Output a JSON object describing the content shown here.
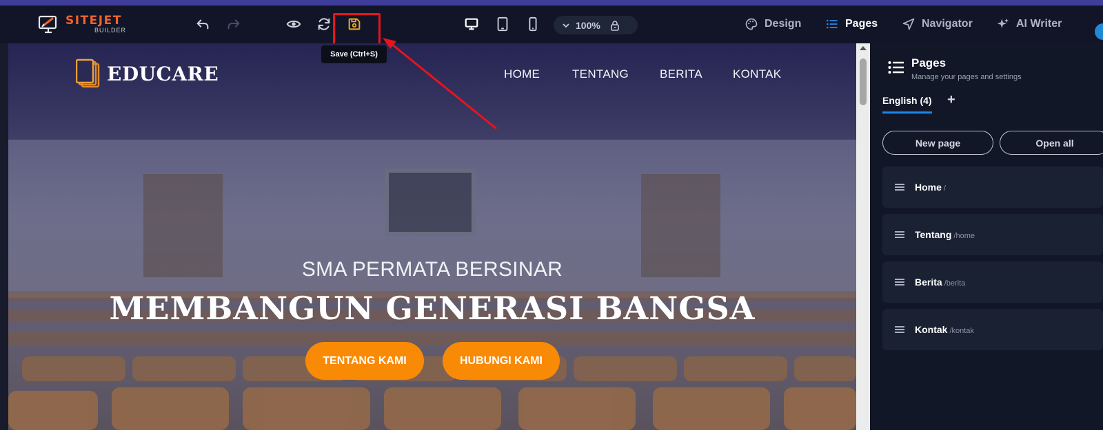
{
  "app": {
    "logo_main": "SITEJET",
    "logo_sub": "BUILDER",
    "zoom": "100%",
    "tooltip": "Save (Ctrl+S)"
  },
  "toolbar_right": {
    "design": "Design",
    "pages": "Pages",
    "navigator": "Navigator",
    "ai_writer": "AI Writer"
  },
  "site": {
    "brand": "EDUCARE",
    "nav": [
      "HOME",
      "TENTANG",
      "BERITA",
      "KONTAK"
    ],
    "hero_sub": "SMA PERMATA BERSINAR",
    "hero_title": "MEMBANGUN GENERASI BANGSA",
    "btn_about": "TENTANG KAMI",
    "btn_contact": "HUBUNGI KAMI"
  },
  "panel": {
    "title": "Pages",
    "desc": "Manage your pages and settings",
    "lang_tab": "English (4)",
    "plus": "+",
    "new_page": "New page",
    "open_all": "Open all",
    "pages": [
      {
        "name": "Home",
        "path": "/"
      },
      {
        "name": "Tentang",
        "path": "/home"
      },
      {
        "name": "Berita",
        "path": "/berita"
      },
      {
        "name": "Kontak",
        "path": "/kontak"
      }
    ]
  },
  "colors": {
    "accent_orange": "#f98a06",
    "active_blue": "#1f86ec",
    "highlight_red": "#e8141d",
    "save_icon": "#f5a623",
    "brand_orange": "#f0642c"
  },
  "icons": {
    "undo": "undo-icon",
    "redo": "redo-icon",
    "preview": "eye-icon",
    "refresh": "refresh-icon",
    "save": "save-icon",
    "desktop": "desktop-icon",
    "tablet": "tablet-icon",
    "mobile": "mobile-icon",
    "lock": "lock-icon"
  }
}
